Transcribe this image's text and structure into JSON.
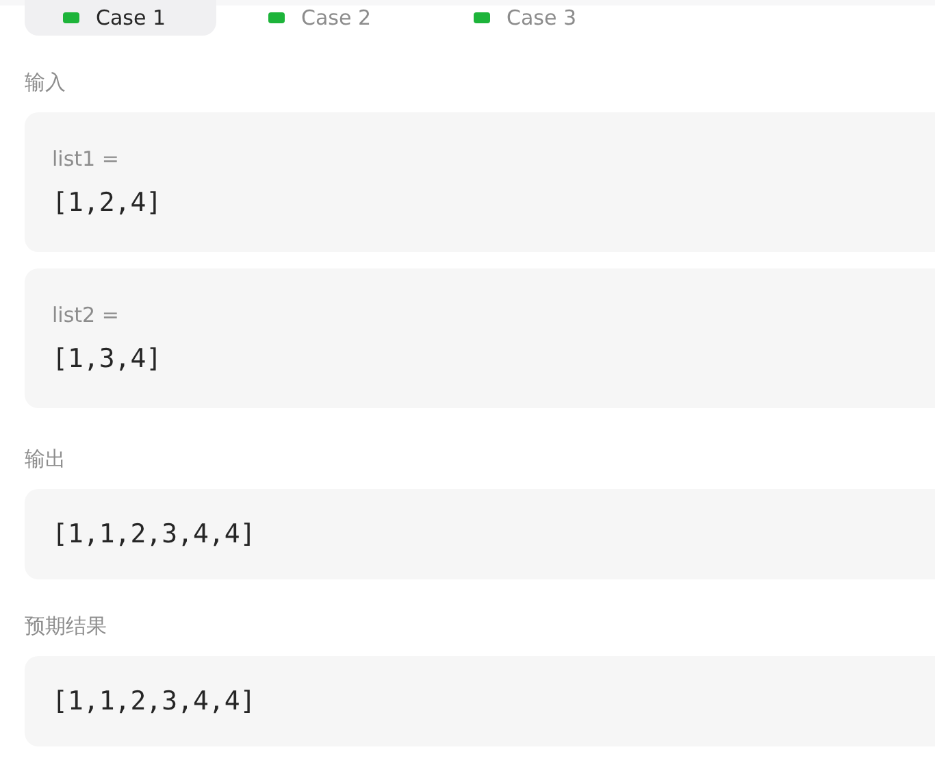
{
  "tabs": [
    {
      "label": "Case 1",
      "selected": true,
      "passed": true
    },
    {
      "label": "Case 2",
      "selected": false,
      "passed": true
    },
    {
      "label": "Case 3",
      "selected": false,
      "passed": true
    }
  ],
  "input": {
    "label": "输入",
    "params": [
      {
        "name": "list1 =",
        "value": "[1,2,4]"
      },
      {
        "name": "list2 =",
        "value": "[1,3,4]"
      }
    ]
  },
  "output": {
    "label": "输出",
    "value": "[1,1,2,3,4,4]"
  },
  "expected": {
    "label": "预期结果",
    "value": "[1,1,2,3,4,4]"
  }
}
